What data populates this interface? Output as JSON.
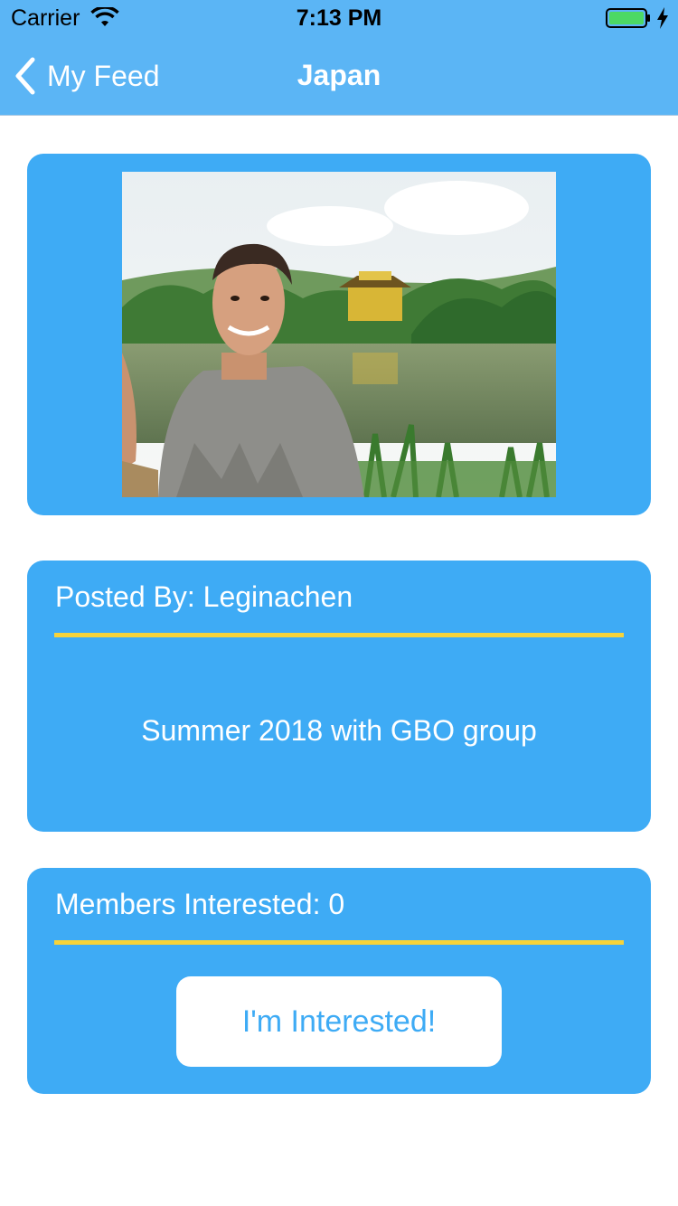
{
  "status_bar": {
    "carrier": "Carrier",
    "time": "7:13 PM",
    "battery_color": "#4cd964",
    "icons": [
      "wifi-icon",
      "battery-icon",
      "charging-bolt-icon"
    ]
  },
  "nav": {
    "back_label": "My Feed",
    "title": "Japan",
    "background": "#5bb5f5",
    "back_icon": "chevron-left-icon"
  },
  "photo_card": {
    "image_description": "photo"
  },
  "post_card": {
    "posted_by": "Posted By: Leginachen",
    "caption": "Summer 2018 with GBO group"
  },
  "members_card": {
    "members_interested": "Members Interested: 0",
    "button_label": "I'm Interested!"
  },
  "colors": {
    "card_blue": "#3eabf5",
    "divider_yellow": "#f6d33a",
    "text_white": "#ffffff"
  }
}
